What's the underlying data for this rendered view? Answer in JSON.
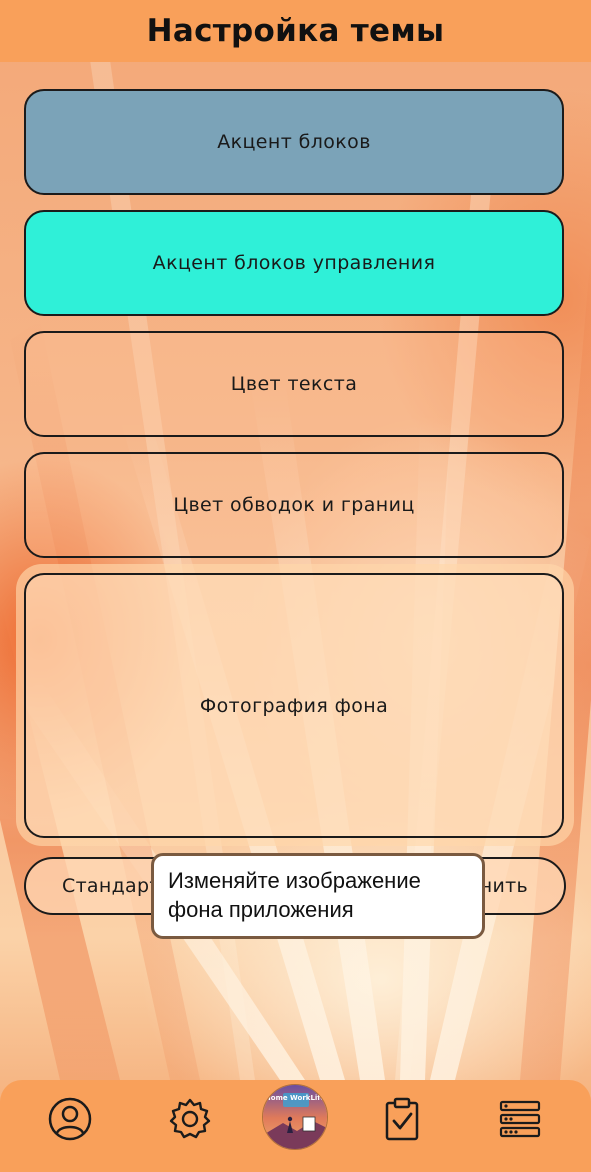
{
  "header": {
    "title": "Настройка темы"
  },
  "blocks": [
    {
      "label": "Акцент блоков",
      "color": "#7ba3b8"
    },
    {
      "label": "Акцент блоков управления",
      "color": "#2ff0d8"
    },
    {
      "label": "Цвет текста"
    },
    {
      "label": "Цвет обводок и границ"
    },
    {
      "label": "Фотография фона"
    }
  ],
  "buttons": {
    "left_label": "Стандарт",
    "right_label": "нить"
  },
  "tooltip": {
    "line1": "Изменяйте изображение",
    "line2": "фона приложения"
  },
  "navbar": {
    "items": [
      {
        "icon": "profile-icon"
      },
      {
        "icon": "settings-gear-icon"
      },
      {
        "icon": "app-avatar",
        "label": "Home WorkLife"
      },
      {
        "icon": "clipboard-check-icon"
      },
      {
        "icon": "list-menu-icon"
      }
    ]
  },
  "colors": {
    "accent_orange": "#f9a05a",
    "control_accent": "#2ff0d8",
    "block_accent": "#7ba3b8"
  }
}
